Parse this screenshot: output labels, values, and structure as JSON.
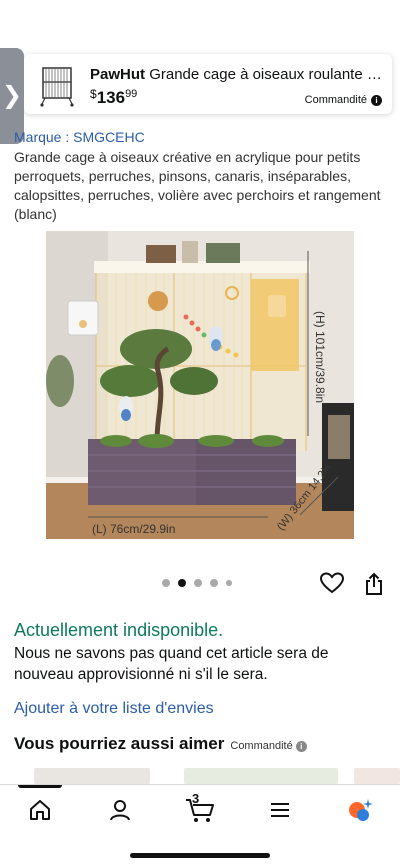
{
  "sponsored_product": {
    "brand": "PawHut",
    "title": "Grande cage à oiseaux roulante e...",
    "price_currency": "$",
    "price_whole": "136",
    "price_cents": "99",
    "sponsored_label": "Commandité"
  },
  "product": {
    "brand_line": "Marque : SMGCEHC",
    "description": "Grande cage à oiseaux créative en acrylique pour petits perroquets, perruches, pinsons, canaris, inséparables, calopsittes, perruches, volière avec perchoirs et rangement (blanc)",
    "image_dimensions": {
      "height": "(H) 101cm/39.8in",
      "depth": "(W) 36cm 14.2in",
      "length": "(L) 76cm/29.9in"
    },
    "carousel": {
      "count": 5,
      "active_index": 1
    }
  },
  "availability": {
    "status": "Actuellement indisponible.",
    "message": "Nous ne savons pas quand cet article sera de nouveau approvisionné ni s'il le sera."
  },
  "wishlist_link": "Ajouter à votre liste d'envies",
  "recommendations": {
    "heading": "Vous pourriez aussi aimer",
    "sponsored_label": "Commandité"
  },
  "bottom_nav": {
    "cart_count": "3"
  },
  "colors": {
    "link": "#2b5da8",
    "unavailable": "#0d7a5f",
    "cage_frame": "#e7c27a",
    "planter": "#6b5a6e"
  },
  "icons": [
    "chevron-right-icon",
    "info-icon",
    "heart-icon",
    "share-icon",
    "home-icon",
    "account-icon",
    "cart-icon",
    "menu-icon",
    "ai-assistant-icon"
  ]
}
